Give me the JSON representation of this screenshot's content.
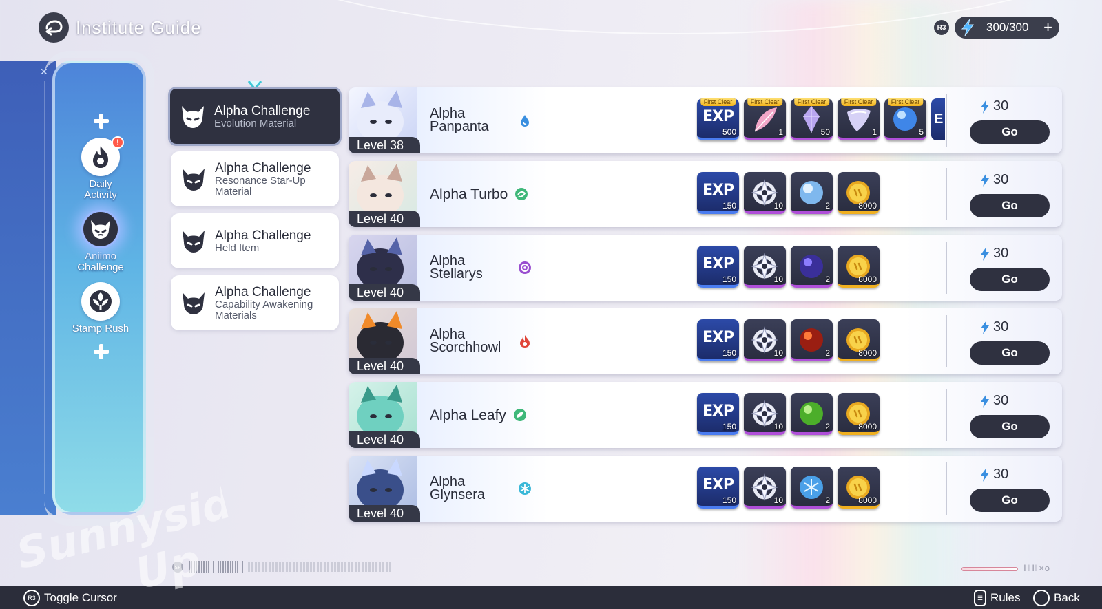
{
  "header": {
    "title": "Institute Guide",
    "stamina_badge": "R3",
    "stamina_value": "300/300",
    "stamina_add": "+"
  },
  "sidebar": {
    "items": [
      {
        "label_line1": "Daily",
        "label_line2": "Activity",
        "alert": "!",
        "icon": "flame-icon"
      },
      {
        "label_line1": "Aniimo",
        "label_line2": "Challenge",
        "icon": "demon-face-icon",
        "active": true
      },
      {
        "label_line1": "Stamp Rush",
        "label_line2": "",
        "icon": "emblem-icon"
      }
    ]
  },
  "categories": [
    {
      "title": "Alpha Challenge",
      "subtitle": "Evolution Material",
      "active": true
    },
    {
      "title": "Alpha Challenge",
      "subtitle": "Resonance Star-Up Material"
    },
    {
      "title": "Alpha Challenge",
      "subtitle": "Held Item"
    },
    {
      "title": "Alpha Challenge",
      "subtitle": "Capability Awakening Materials"
    }
  ],
  "challenges": [
    {
      "level": "Level 38",
      "name_line1": "Alpha",
      "name_line2": "Panpanta",
      "type_icon": "water-drop-icon",
      "type_color": "#3a8fe0",
      "cost": "30",
      "go": "Go",
      "rewards": [
        {
          "kind": "exp",
          "label": "EXP",
          "qty": "500",
          "first_clear": "First Clear"
        },
        {
          "kind": "feather",
          "qty": "1",
          "first_clear": "First Clear"
        },
        {
          "kind": "crystal",
          "qty": "50",
          "first_clear": "First Clear"
        },
        {
          "kind": "gem",
          "qty": "1",
          "first_clear": "First Clear"
        },
        {
          "kind": "orb",
          "qty": "5",
          "first_clear": "First Clear"
        }
      ],
      "peek": "E"
    },
    {
      "level": "Level 40",
      "name": "Alpha Turbo",
      "type_icon": "leaf-swirl-icon",
      "type_color": "#3fb87a",
      "cost": "30",
      "go": "Go",
      "rewards": [
        {
          "kind": "exp",
          "label": "EXP",
          "qty": "150"
        },
        {
          "kind": "ring",
          "qty": "10"
        },
        {
          "kind": "orb-blue",
          "qty": "2"
        },
        {
          "kind": "coin",
          "qty": "8000"
        }
      ]
    },
    {
      "level": "Level 40",
      "name_line1": "Alpha",
      "name_line2": "Stellarys",
      "type_icon": "spiral-icon",
      "type_color": "#9a4fd0",
      "cost": "30",
      "go": "Go",
      "rewards": [
        {
          "kind": "exp",
          "label": "EXP",
          "qty": "150"
        },
        {
          "kind": "ring",
          "qty": "10"
        },
        {
          "kind": "orb-purple",
          "qty": "2"
        },
        {
          "kind": "coin",
          "qty": "8000"
        }
      ]
    },
    {
      "level": "Level 40",
      "name_line1": "Alpha",
      "name_line2": "Scorchhowl",
      "type_icon": "fire-icon",
      "type_color": "#e0463a",
      "cost": "30",
      "go": "Go",
      "rewards": [
        {
          "kind": "exp",
          "label": "EXP",
          "qty": "150"
        },
        {
          "kind": "ring",
          "qty": "10"
        },
        {
          "kind": "orb-red",
          "qty": "2"
        },
        {
          "kind": "coin",
          "qty": "8000"
        }
      ]
    },
    {
      "level": "Level 40",
      "name": "Alpha Leafy",
      "type_icon": "leaf-icon",
      "type_color": "#3fb87a",
      "cost": "30",
      "go": "Go",
      "rewards": [
        {
          "kind": "exp",
          "label": "EXP",
          "qty": "150"
        },
        {
          "kind": "ring",
          "qty": "10"
        },
        {
          "kind": "orb-green",
          "qty": "2"
        },
        {
          "kind": "coin",
          "qty": "8000"
        }
      ]
    },
    {
      "level": "Level 40",
      "name_line1": "Alpha",
      "name_line2": "Glynsera",
      "type_icon": "snowflake-icon",
      "type_color": "#3ab8d8",
      "cost": "30",
      "go": "Go",
      "rewards": [
        {
          "kind": "exp",
          "label": "EXP",
          "qty": "150"
        },
        {
          "kind": "ring",
          "qty": "10"
        },
        {
          "kind": "orb-ice",
          "qty": "2"
        },
        {
          "kind": "coin",
          "qty": "8000"
        }
      ]
    }
  ],
  "footer": {
    "toggle_badge": "R3",
    "toggle_label": "Toggle Cursor",
    "rules_label": "Rules",
    "back_label": "Back",
    "deco_right": "ⅠⅡⅢ×o"
  },
  "watermark": "Sunnyside Up",
  "colors": {
    "dark_ui": "#2f3140",
    "rail_blue": "#4d84d9",
    "first_clear_gold": "#f3b31a",
    "stamina_blue": "#3a8fe0"
  }
}
